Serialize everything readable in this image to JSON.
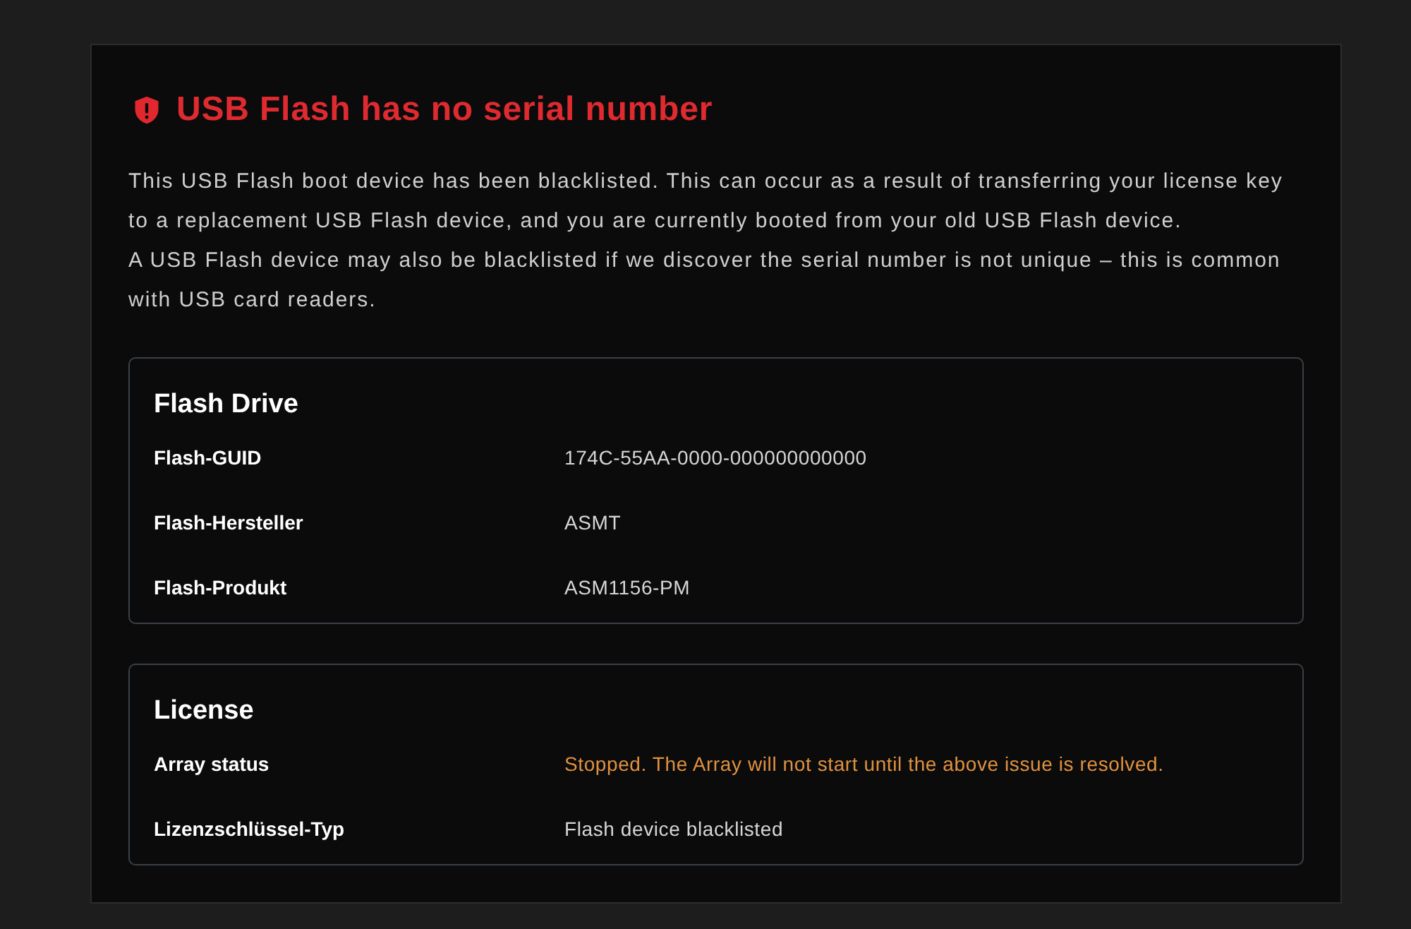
{
  "alert": {
    "title": "USB Flash has no serial number",
    "paragraphs": [
      "This USB Flash boot device has been blacklisted. This can occur as a result of transferring your license key to a replacement USB Flash device, and you are currently booted from your old USB Flash device.",
      "A USB Flash device may also be blacklisted if we discover the serial number is not unique – this is common with USB card readers."
    ]
  },
  "sections": [
    {
      "title": "Flash Drive",
      "rows": [
        {
          "label": "Flash-GUID",
          "value": "174C-55AA-0000-000000000000",
          "kind": "plain"
        },
        {
          "label": "Flash-Hersteller",
          "value": "ASMT",
          "kind": "plain"
        },
        {
          "label": "Flash-Produkt",
          "value": "ASM1156-PM",
          "kind": "plain"
        }
      ]
    },
    {
      "title": "License",
      "rows": [
        {
          "label": "Array status",
          "value": "Stopped. The Array will not start until the above issue is resolved.",
          "kind": "warning"
        },
        {
          "label": "Lizenzschlüssel-Typ",
          "value": "Flash device blacklisted",
          "kind": "plain"
        }
      ]
    }
  ]
}
